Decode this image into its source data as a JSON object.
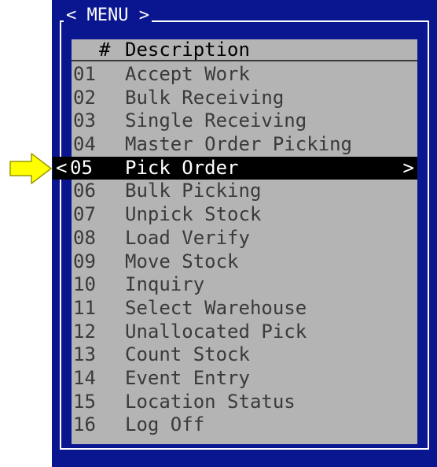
{
  "colors": {
    "terminal_bg": "#0a1690",
    "panel_bg": "#b4b4b4",
    "text": "#3a3a3a",
    "selected_bg": "#000000",
    "selected_text": "#ffffff",
    "pointer_arrow": "#ffff00"
  },
  "pointer": {
    "icon": "right-arrow-icon"
  },
  "menu": {
    "title": "< MENU >",
    "header": {
      "number": "#",
      "description": "Description"
    },
    "items": [
      {
        "number": "01",
        "label": "Accept Work"
      },
      {
        "number": "02",
        "label": "Bulk Receiving"
      },
      {
        "number": "03",
        "label": "Single Receiving"
      },
      {
        "number": "04",
        "label": "Master Order Picking"
      },
      {
        "number": "05",
        "label": "Pick Order",
        "selected": true,
        "prefix": "<",
        "suffix": ">"
      },
      {
        "number": "06",
        "label": "Bulk Picking"
      },
      {
        "number": "07",
        "label": "Unpick Stock"
      },
      {
        "number": "08",
        "label": "Load Verify"
      },
      {
        "number": "09",
        "label": "Move Stock"
      },
      {
        "number": "10",
        "label": "Inquiry"
      },
      {
        "number": "11",
        "label": "Select Warehouse"
      },
      {
        "number": "12",
        "label": "Unallocated Pick"
      },
      {
        "number": "13",
        "label": "Count Stock"
      },
      {
        "number": "14",
        "label": "Event Entry"
      },
      {
        "number": "15",
        "label": "Location Status"
      },
      {
        "number": "16",
        "label": "Log Off"
      }
    ]
  }
}
